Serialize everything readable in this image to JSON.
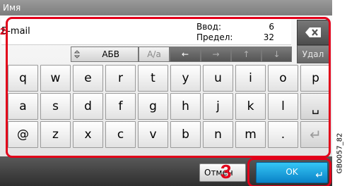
{
  "title": "Имя",
  "input": {
    "value": "E-mail",
    "entered_label": "Ввод:",
    "entered_value": "6",
    "limit_label": "Предел:",
    "limit_value": "32"
  },
  "buttons": {
    "backspace_icon": "backspace-icon",
    "delete_label": "Удал",
    "cancel_label": "Отмен",
    "ok_label": "OK"
  },
  "controls": {
    "charset_label": "АБВ",
    "case_label": "A/a",
    "left_arrow": "←",
    "right_arrow": "→",
    "up_arrow": "↑",
    "down_arrow": "↓"
  },
  "keyboard": {
    "row1": [
      "q",
      "w",
      "e",
      "r",
      "t",
      "y",
      "u",
      "i",
      "o",
      "p"
    ],
    "row2": [
      "a",
      "s",
      "d",
      "f",
      "g",
      "h",
      "j",
      "k",
      "l"
    ],
    "row3": [
      "@",
      "z",
      "x",
      "c",
      "v",
      "b",
      "n",
      "m",
      "."
    ],
    "space_symbol": "␣",
    "enter_symbol": "↵"
  },
  "callouts": {
    "first": "2",
    "second": "3"
  },
  "figure_code": "GB0057_82",
  "colors": {
    "callout": "#e2001a",
    "ok_button": "#1aa3e0"
  }
}
